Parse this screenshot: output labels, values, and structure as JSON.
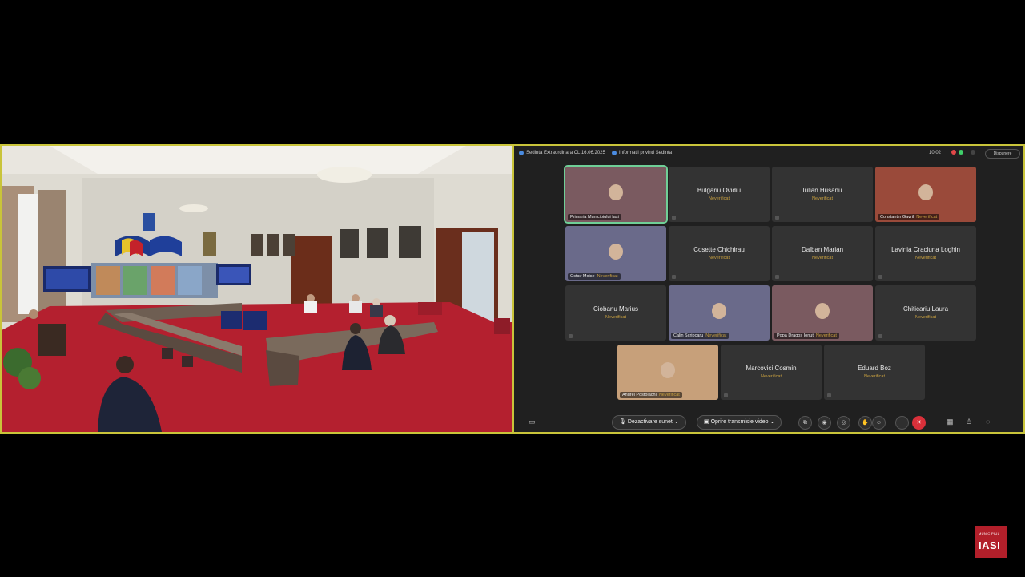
{
  "meeting": {
    "title": "Sedinta Extraordinara CL 16.06.2025",
    "info_label": "Informatii privind Sedinta",
    "time": "10:02",
    "layout_label": "Dispunere"
  },
  "participants": [
    {
      "name": "Primaria Municipiului Iasi",
      "status": "",
      "video": true,
      "active": true
    },
    {
      "name": "Bulgariu Ovidiu",
      "status": "Neverificat",
      "video": false
    },
    {
      "name": "Iulian Husanu",
      "status": "Neverificat",
      "video": false
    },
    {
      "name": "Constantin Gavril",
      "status": "Neverificat",
      "video": true
    },
    {
      "name": "Octav Moise",
      "status": "Neverificat",
      "video": true
    },
    {
      "name": "Cosette Chichirau",
      "status": "Neverificat",
      "video": false
    },
    {
      "name": "Dalban Marian",
      "status": "Neverificat",
      "video": false
    },
    {
      "name": "Lavinia Craciuna Loghin",
      "status": "Neverificat",
      "video": false
    },
    {
      "name": "Ciobanu Marius",
      "status": "Neverificat",
      "video": false
    },
    {
      "name": "Calin Scripcaru",
      "status": "Neverificat",
      "video": true
    },
    {
      "name": "Popa Dragos Ionut",
      "status": "Neverificat",
      "video": true
    },
    {
      "name": "Chiticariu Laura",
      "status": "Neverificat",
      "video": false
    },
    {
      "name": "Andrei Postolachi",
      "status": "Neverificat",
      "video": true
    },
    {
      "name": "Marcovici Cosmin",
      "status": "Neverificat",
      "video": false
    },
    {
      "name": "Eduard Boz",
      "status": "Neverificat",
      "video": false
    }
  ],
  "controls": {
    "mute_label": "Dezactivare sunet",
    "video_label": "Oprire transmisie video"
  },
  "logo": {
    "small": "MUNICIPIUL",
    "big": "IASI"
  },
  "colors": {
    "frame": "#c9c43a",
    "active_speaker": "#6fcf97",
    "status": "#c8a040",
    "leave": "#d9303a",
    "carpet": "#b01c2e"
  }
}
